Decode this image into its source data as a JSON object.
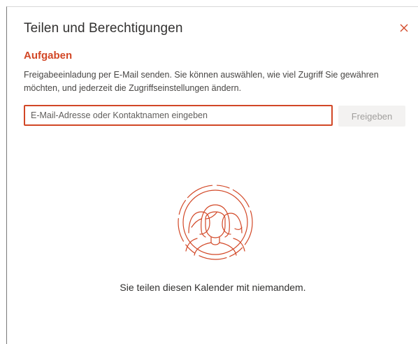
{
  "dialog": {
    "title": "Teilen und Berechtigungen",
    "close_icon": "close-icon"
  },
  "tasks": {
    "heading": "Aufgaben",
    "description": "Freigabeeinladung per E-Mail senden. Sie können auswählen, wie viel Zugriff Sie gewähren möchten, und jederzeit die Zugriffseinstellungen ändern."
  },
  "share": {
    "input_placeholder": "E-Mail-Adresse oder Kontaktnamen eingeben",
    "input_value": "",
    "button_label": "Freigeben"
  },
  "empty_state": {
    "illustration_icon": "people-illustration-icon",
    "message": "Sie teilen diesen Kalender mit niemandem."
  },
  "colors": {
    "accent": "#d24726",
    "button_disabled_bg": "#f3f2f1",
    "button_disabled_text": "#a19f9d"
  }
}
